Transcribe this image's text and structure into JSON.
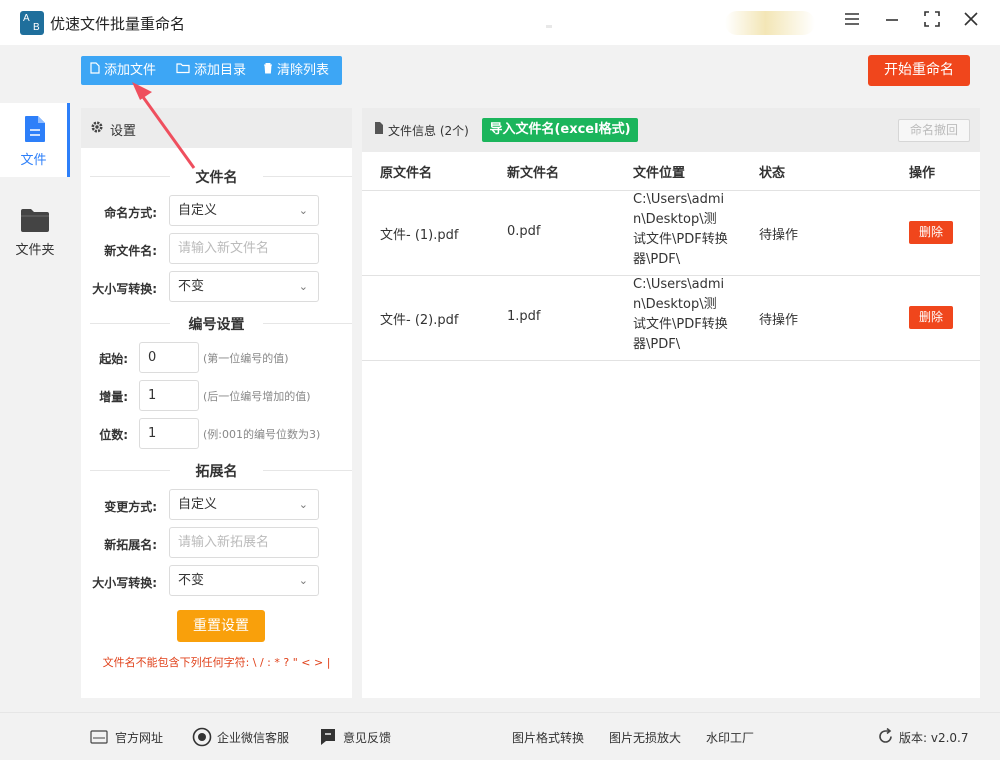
{
  "app": {
    "logo_text": "AB",
    "title": "优速文件批量重命名"
  },
  "window_controls": {
    "menu_icon": "menu-icon",
    "minimize_icon": "minimize-icon",
    "maximize_icon": "maximize-icon",
    "close_icon": "close-icon"
  },
  "nav": {
    "items": [
      {
        "label": "文件",
        "icon": "file-icon",
        "active": true
      },
      {
        "label": "文件夹",
        "icon": "folder-icon",
        "active": false
      }
    ]
  },
  "toolbar": {
    "add_file": "添加文件",
    "add_dir": "添加目录",
    "clear_list": "清除列表",
    "start_rename": "开始重命名"
  },
  "settings": {
    "header": "设置",
    "filename_section": "文件名",
    "naming_mode_label": "命名方式:",
    "naming_mode_value": "自定义",
    "new_name_label": "新文件名:",
    "new_name_placeholder": "请输入新文件名",
    "case_label": "大小写转换:",
    "case_value": "不变",
    "numbering_section": "编号设置",
    "start_label": "起始:",
    "start_value": "0",
    "start_hint": "(第一位编号的值)",
    "step_label": "增量:",
    "step_value": "1",
    "step_hint": "(后一位编号增加的值)",
    "digits_label": "位数:",
    "digits_value": "1",
    "digits_hint": "(例:001的编号位数为3)",
    "ext_section": "拓展名",
    "change_mode_label": "变更方式:",
    "change_mode_value": "自定义",
    "new_ext_label": "新拓展名:",
    "new_ext_placeholder": "请输入新拓展名",
    "ext_case_label": "大小写转换:",
    "ext_case_value": "不变",
    "reset_button": "重置设置",
    "warning": "文件名不能包含下列任何字符: \\ / : * ? \" < > |"
  },
  "files": {
    "header": "文件信息 (2个)",
    "import_button": "导入文件名(excel格式)",
    "undo_button": "命名撤回",
    "columns": [
      "原文件名",
      "新文件名",
      "文件位置",
      "状态",
      "操作"
    ],
    "rows": [
      {
        "original": "文件- (1).pdf",
        "new": "0.pdf",
        "location": "C:\\Users\\admin\\Desktop\\测试文件\\PDF转换器\\PDF\\",
        "status": "待操作",
        "action": "删除"
      },
      {
        "original": "文件- (2).pdf",
        "new": "1.pdf",
        "location": "C:\\Users\\admin\\Desktop\\测试文件\\PDF转换器\\PDF\\",
        "status": "待操作",
        "action": "删除"
      }
    ]
  },
  "footer": {
    "website": "官方网址",
    "wechat": "企业微信客服",
    "feedback": "意见反馈",
    "img_convert": "图片格式转换",
    "img_enlarge": "图片无损放大",
    "watermark": "水印工厂",
    "version": "版本: v2.0.7"
  },
  "colors": {
    "accent_blue": "#3da6f5",
    "start_red": "#f0461c",
    "import_green": "#1bb55c",
    "reset_orange": "#f9a00b",
    "nav_active": "#2d7ff9"
  }
}
